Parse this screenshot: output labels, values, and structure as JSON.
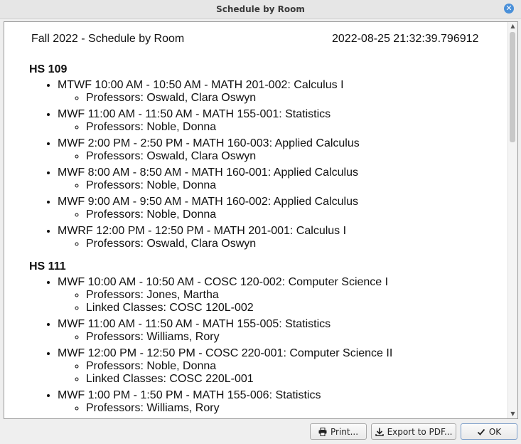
{
  "window": {
    "title": "Schedule by Room",
    "close_icon": "close-icon"
  },
  "header": {
    "left": "Fall 2022 - Schedule by Room",
    "right": "2022-08-25 21:32:39.796912"
  },
  "rooms": [
    {
      "name": "HS 109",
      "classes": [
        {
          "title": "MTWF 10:00 AM - 10:50 AM - MATH 201-002: Calculus I",
          "details": [
            "Professors: Oswald, Clara Oswyn"
          ]
        },
        {
          "title": "MWF 11:00 AM - 11:50 AM - MATH 155-001: Statistics",
          "details": [
            "Professors: Noble, Donna"
          ]
        },
        {
          "title": "MWF 2:00 PM - 2:50 PM - MATH 160-003: Applied Calculus",
          "details": [
            "Professors: Oswald, Clara Oswyn"
          ]
        },
        {
          "title": "MWF 8:00 AM - 8:50 AM - MATH 160-001: Applied Calculus",
          "details": [
            "Professors: Noble, Donna"
          ]
        },
        {
          "title": "MWF 9:00 AM - 9:50 AM - MATH 160-002: Applied Calculus",
          "details": [
            "Professors: Noble, Donna"
          ]
        },
        {
          "title": "MWRF 12:00 PM - 12:50 PM - MATH 201-001: Calculus I",
          "details": [
            "Professors: Oswald, Clara Oswyn"
          ]
        }
      ]
    },
    {
      "name": "HS 111",
      "classes": [
        {
          "title": "MWF 10:00 AM - 10:50 AM - COSC 120-002: Computer Science I",
          "details": [
            "Professors: Jones, Martha",
            "Linked Classes: COSC 120L-002"
          ]
        },
        {
          "title": "MWF 11:00 AM - 11:50 AM - MATH 155-005: Statistics",
          "details": [
            "Professors: Williams, Rory"
          ]
        },
        {
          "title": "MWF 12:00 PM - 12:50 PM - COSC 220-001: Computer Science II",
          "details": [
            "Professors: Noble, Donna",
            "Linked Classes: COSC 220L-001"
          ]
        },
        {
          "title": "MWF 1:00 PM - 1:50 PM - MATH 155-006: Statistics",
          "details": [
            "Professors: Williams, Rory"
          ]
        }
      ]
    }
  ],
  "buttons": {
    "print": {
      "label": "Print...",
      "icon": "printer-icon"
    },
    "export": {
      "label": "Export to PDF...",
      "icon": "download-icon"
    },
    "ok": {
      "label": "OK",
      "icon": "check-icon"
    }
  }
}
